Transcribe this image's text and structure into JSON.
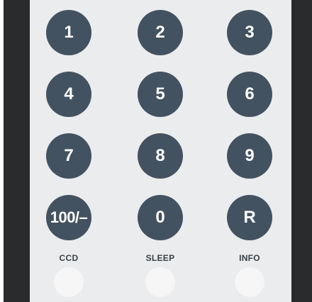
{
  "keypad": {
    "row1": [
      "1",
      "2",
      "3"
    ],
    "row2": [
      "4",
      "5",
      "6"
    ],
    "row3": [
      "7",
      "8",
      "9"
    ],
    "row4": [
      "100/–",
      "0",
      "R"
    ]
  },
  "function_keys": {
    "ccd_label": "CCD",
    "sleep_label": "SLEEP",
    "info_label": "INFO"
  },
  "colors": {
    "key_fill": "#435260",
    "key_text": "#ffffff",
    "panel": "#ebeced",
    "rail": "#2a2b2c"
  }
}
